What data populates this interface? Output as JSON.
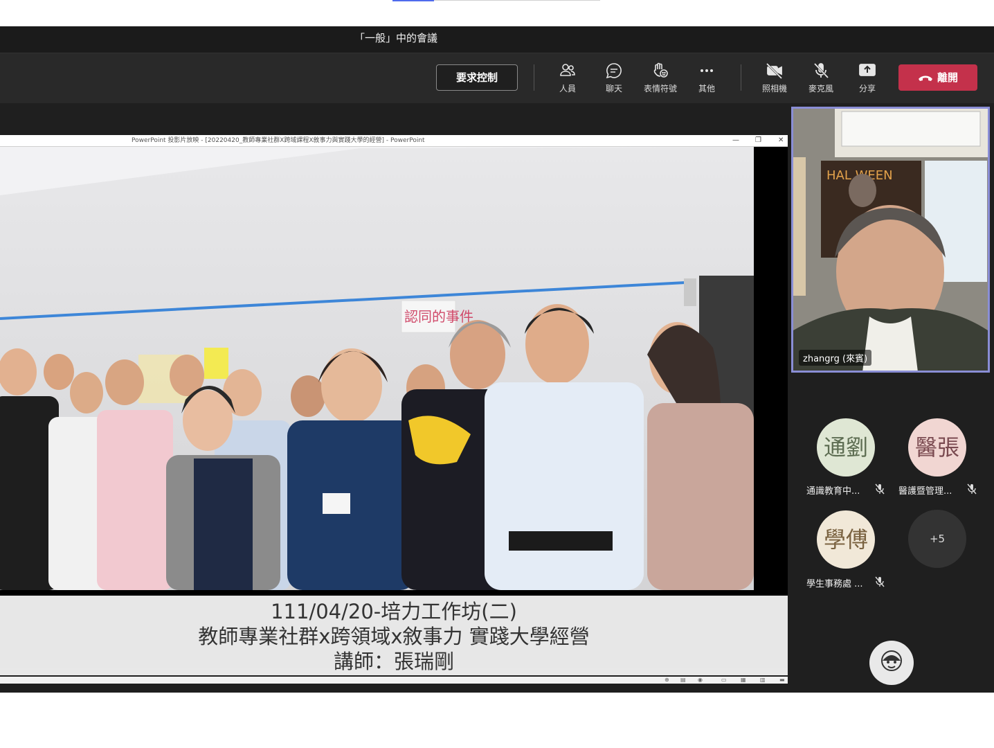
{
  "window": {
    "title": "「一般」中的會議"
  },
  "toolbar": {
    "request_control_label": "要求控制",
    "people_label": "人員",
    "chat_label": "聊天",
    "reactions_label": "表情符號",
    "more_label": "其他",
    "camera_label": "照相機",
    "mic_label": "麥克風",
    "share_label": "分享",
    "leave_label": "離開",
    "leave_color": "#c4314b"
  },
  "shared_content": {
    "ppt_window_title": "PowerPoint 投影片放映 - [20220420_教師專業社群X跨域課程X敘事力與實踐大學的經營] - PowerPoint",
    "caption_line1": "111/04/20-培力工作坊(二)",
    "caption_line2": "教師專業社群x跨領域x敘事力 實踐大學經營",
    "caption_line3": "講師：張瑞剛",
    "whiteboard_note": "認同的事件"
  },
  "participants": {
    "active_speaker": {
      "name": "zhangrg (來賓)",
      "highlight_color": "#8a8ed6"
    },
    "others": [
      {
        "initials": "通劉",
        "name": "通識教育中...",
        "muted": true,
        "avatar_color": "#dfe7d4"
      },
      {
        "initials": "醫張",
        "name": "醫護暨管理...",
        "muted": true,
        "avatar_color": "#f1d6d2"
      },
      {
        "initials": "學傅",
        "name": "學生事務處 ...",
        "muted": true,
        "avatar_color": "#f1e8d8"
      }
    ],
    "overflow_count": "+5"
  }
}
